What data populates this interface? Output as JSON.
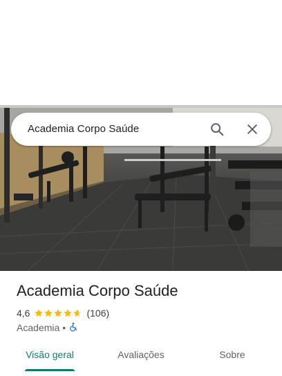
{
  "search": {
    "query": "Academia Corpo Saúde"
  },
  "place": {
    "name": "Academia Corpo Saúde",
    "rating": "4,6",
    "rating_value": 4.6,
    "review_count": "(106)",
    "category": "Academia",
    "separator": "•",
    "accessibility_icon": "wheelchair-icon"
  },
  "tabs": [
    {
      "label": "Visão geral",
      "active": true
    },
    {
      "label": "Avaliações",
      "active": false
    },
    {
      "label": "Sobre",
      "active": false
    }
  ],
  "colors": {
    "star": "#fbbc04",
    "accent": "#0f7b6f",
    "accessibility": "#1a73e8"
  }
}
